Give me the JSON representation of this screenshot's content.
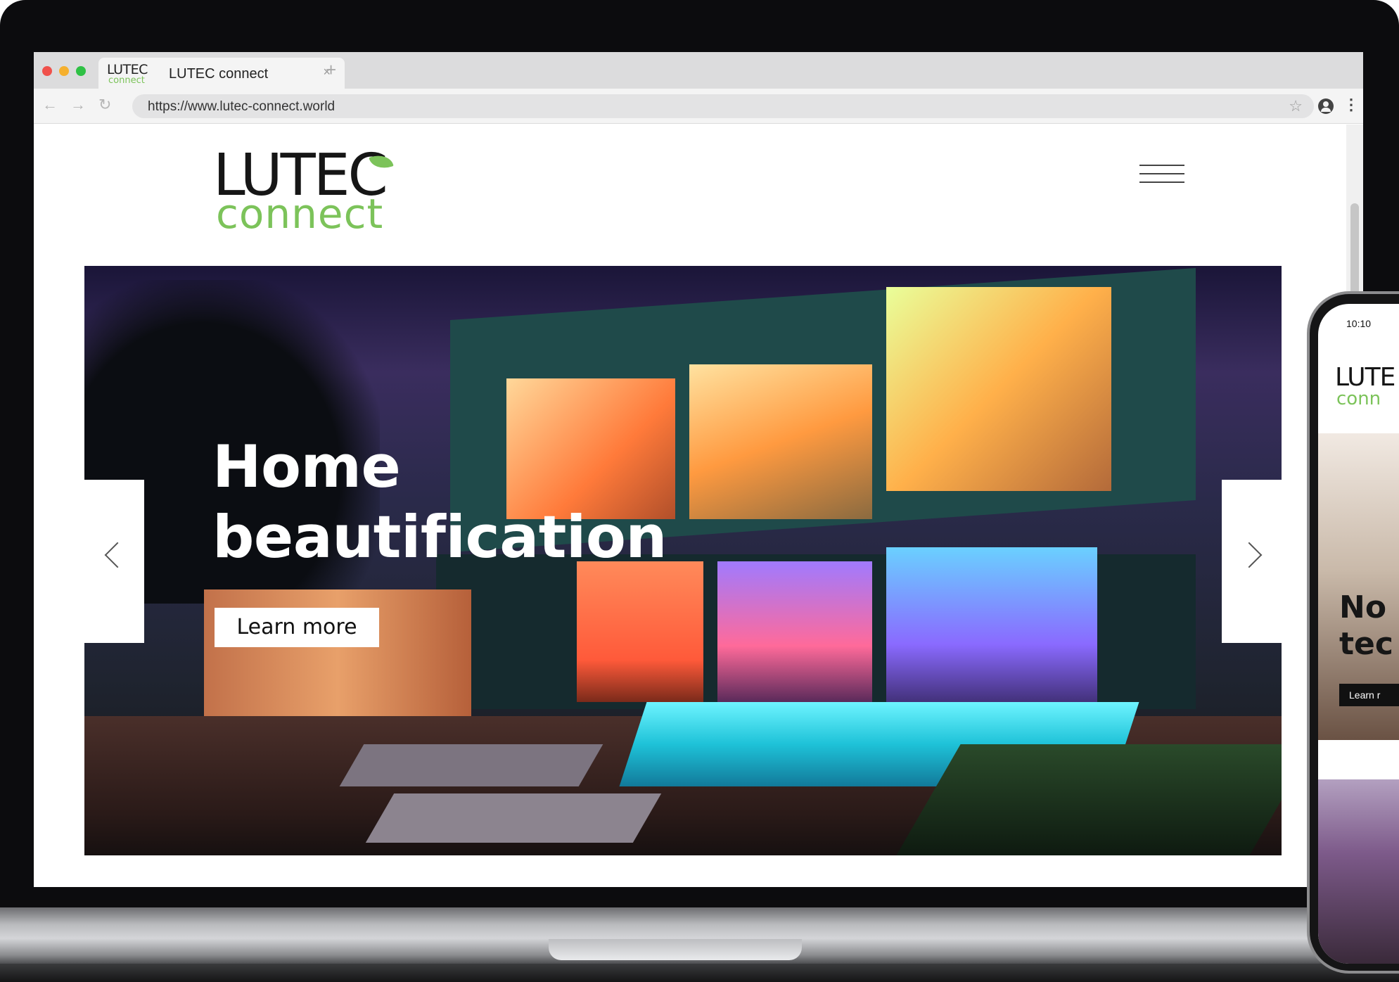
{
  "browser": {
    "tab": {
      "favicon_text_top": "LUTEC",
      "favicon_text_bottom": "connect",
      "title": "LUTEC connect",
      "close_glyph": "×"
    },
    "new_tab_glyph": "+",
    "url": "https://www.lutec-connect.world",
    "icons": [
      "back-arrow-icon",
      "forward-arrow-icon",
      "reload-icon",
      "star-icon",
      "profile-icon",
      "kebab-menu-icon"
    ]
  },
  "site": {
    "logo": {
      "word": "LUTEC",
      "sub": "connect",
      "accent_color": "#7cc35a"
    },
    "hero": {
      "title_line_1": "Home",
      "title_line_2": "beautification",
      "cta_label": "Learn more"
    }
  },
  "phone": {
    "time": "10:10",
    "logo_word": "LUTE",
    "logo_sub": "conn",
    "heading_line_1": "No",
    "heading_line_2": "tec",
    "cta_label": "Learn r"
  }
}
